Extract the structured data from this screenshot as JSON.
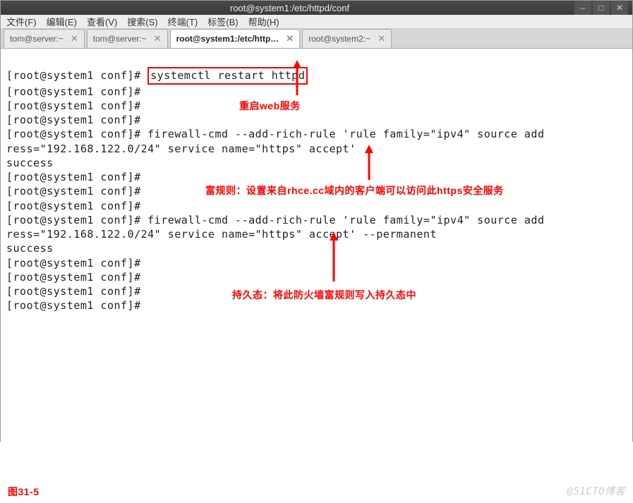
{
  "titlebar": {
    "title": "root@system1:/etc/httpd/conf"
  },
  "win_controls": {
    "min": "–",
    "max": "□",
    "close": "✕"
  },
  "menu": {
    "file": "文件(F)",
    "edit": "编辑(E)",
    "view": "查看(V)",
    "search": "搜索(S)",
    "terminal": "终端(T)",
    "tabs": "标签(B)",
    "help": "帮助(H)"
  },
  "tabs": [
    {
      "label": "tom@server:~",
      "active": false
    },
    {
      "label": "tom@server:~",
      "active": false
    },
    {
      "label": "root@system1:/etc/http…",
      "active": true
    },
    {
      "label": "root@system2:~",
      "active": false
    }
  ],
  "tab_close": "✕",
  "term": {
    "prompt": "[root@system1 conf]#",
    "cmd1": "systemctl restart httpd",
    "cmd2a": "firewall-cmd --add-rich-rule 'rule family=\"ipv4\" source add",
    "cmd2b": "ress=\"192.168.122.0/24\" service name=\"https\" accept'",
    "success": "success",
    "cmd3a": "firewall-cmd --add-rich-rule 'rule family=\"ipv4\" source add",
    "cmd3b": "ress=\"192.168.122.0/24\" service name=\"https\" accept' --permanent"
  },
  "annotations": {
    "a1": "重启web服务",
    "a2": "富规则：设置来自rhce.cc域内的客户端可以访问此https安全服务",
    "a3": "持久态：将此防火墙富规则写入持久态中"
  },
  "figure_label": "图31-5",
  "watermark": "@51CTO博客"
}
